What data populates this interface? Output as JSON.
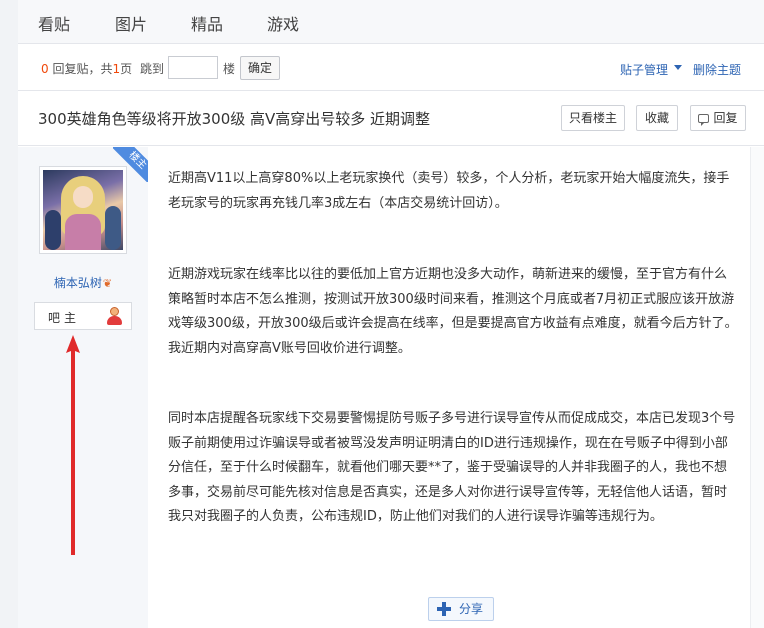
{
  "nav": {
    "tabs": [
      "看贴",
      "图片",
      "精品",
      "游戏"
    ]
  },
  "toolbar": {
    "reply_count": "0",
    "reply_label": " 回复贴，共",
    "page_count": "1",
    "page_unit": "页",
    "jump_label": "跳到",
    "floor_label": "楼",
    "confirm": "确定",
    "manage": "贴子管理",
    "delete": "删除主题"
  },
  "post": {
    "title": "300英雄角色等级将开放300级 高V高穿出号较多 近期调整",
    "only_op": "只看楼主",
    "favorite": "收藏",
    "reply": "回复"
  },
  "author": {
    "ribbon": "楼主",
    "name": "楠本弘树",
    "badge": "吧主"
  },
  "content": {
    "paragraphs": [
      "近期高V11以上高穿80%以上老玩家换代（卖号）较多，个人分析，老玩家开始大幅度流失，接手老玩家号的玩家再充钱几率3成左右（本店交易统计回访）。",
      "近期游戏玩家在线率比以往的要低加上官方近期也没多大动作，萌新进来的缓慢，至于官方有什么策略暂时本店不怎么推测，按测试开放300级时间来看，推测这个月底或者7月初正式服应该开放游戏等级300级，开放300级后或许会提高在线率，但是要提高官方收益有点难度，就看今后方针了。我近期内对高穿高V账号回收价进行调整。",
      "同时本店提醒各玩家线下交易要警惕提防号贩子多号进行误导宣传从而促成成交，本店已发现3个号贩子前期使用过诈骗误导或者被骂没发声明证明清白的ID进行违规操作，现在在号贩子中得到小部分信任，至于什么时候翻车，就看他们哪天要**了，鉴于受骗误导的人并非我圈子的人，我也不想多事，交易前尽可能先核对信息是否真实，还是多人对你进行误导宣传等，无轻信他人话语，暂时我只对我圈子的人负责，公布违规ID，防止他们对我们的人进行误导诈骗等违规行为。"
    ]
  },
  "share": "分享",
  "colors": {
    "link": "#2d64b3",
    "accent_red": "#f0480b",
    "ribbon_blue": "#4f8be0",
    "arrow_red": "#e02a2a"
  }
}
